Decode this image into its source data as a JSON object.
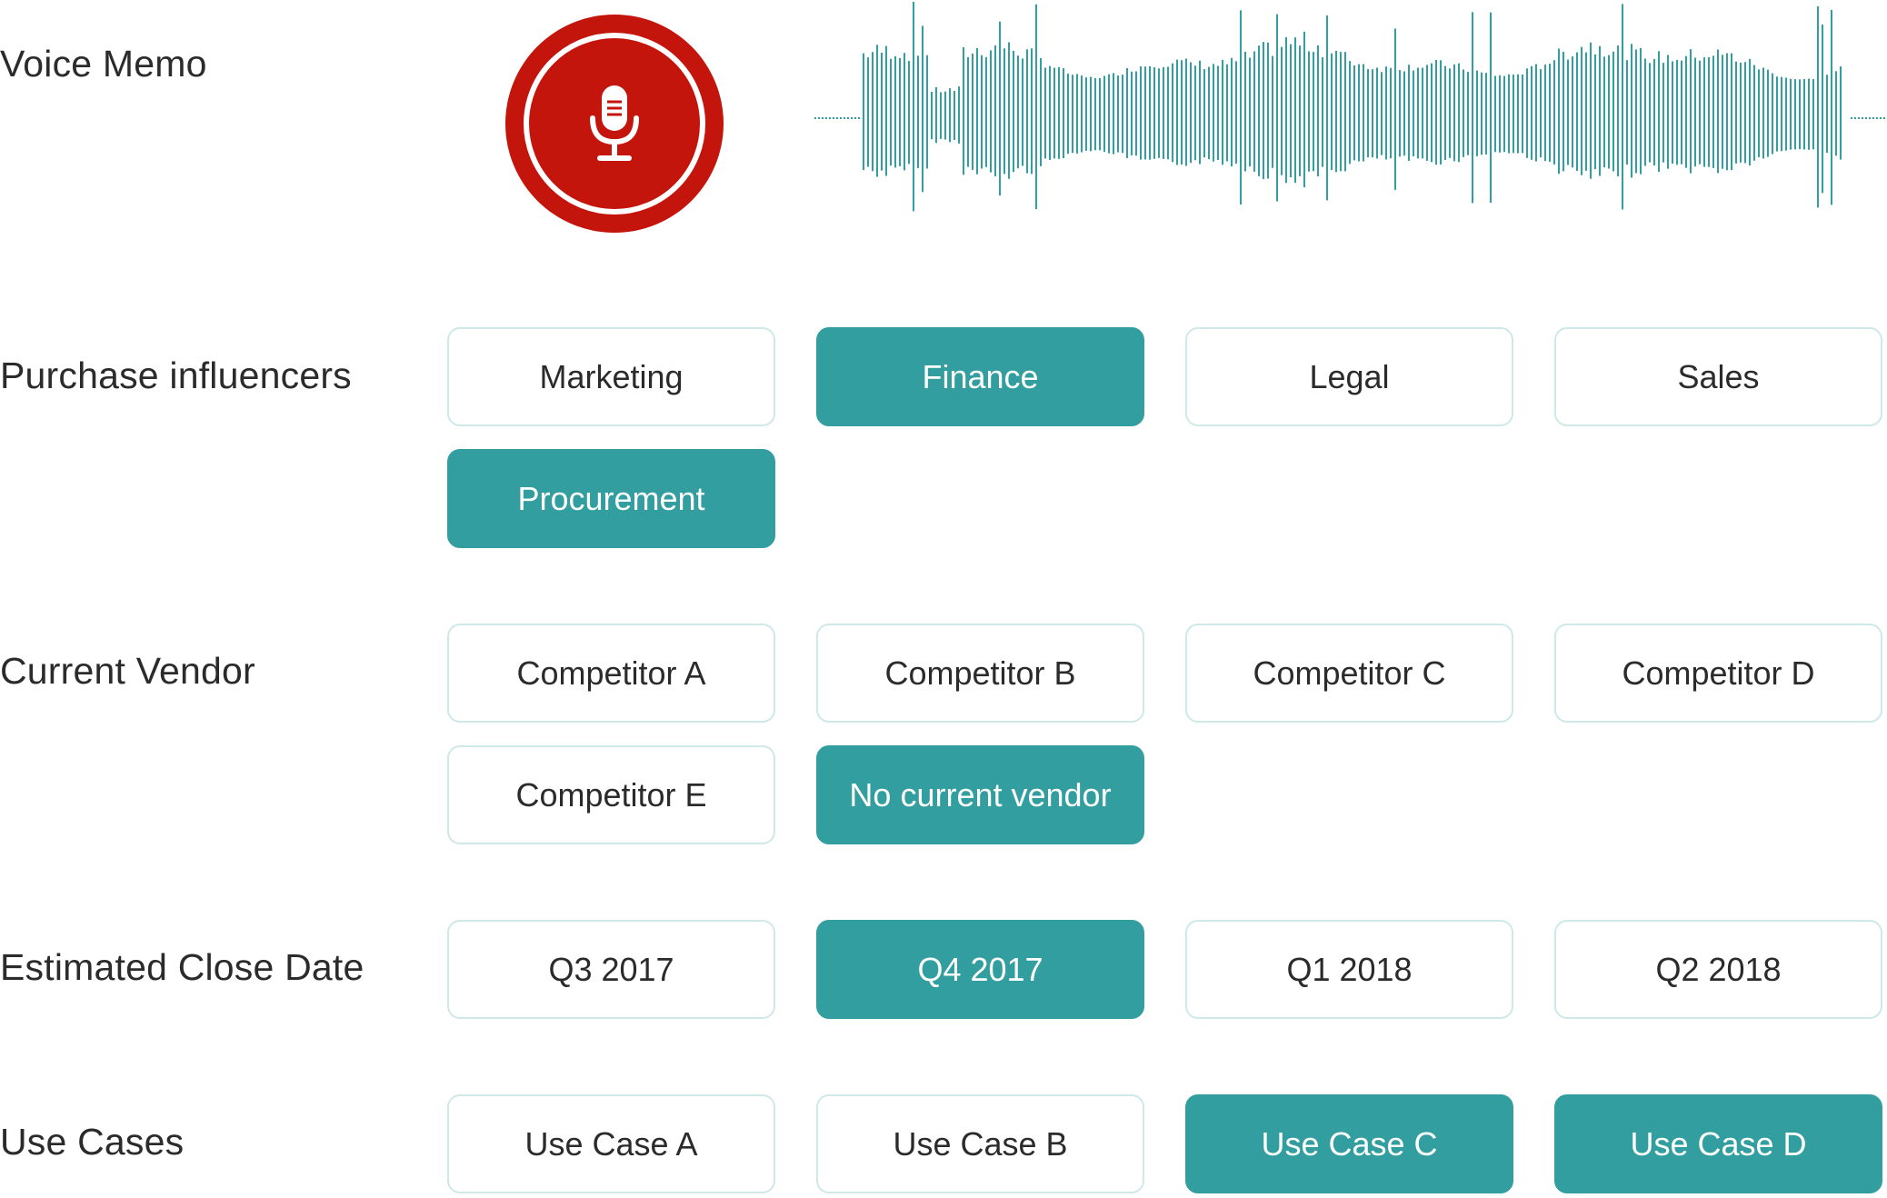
{
  "colors": {
    "accent": "#339e9f",
    "chip_border": "#cfe8e8",
    "record": "#c4150d",
    "waveform": "#339e9f",
    "text": "#2b2b2b"
  },
  "voice_memo": {
    "label": "Voice Memo",
    "record_icon": "microphone-icon"
  },
  "purchase_influencers": {
    "label": "Purchase influencers",
    "options": [
      {
        "label": "Marketing",
        "selected": false
      },
      {
        "label": "Finance",
        "selected": true
      },
      {
        "label": "Legal",
        "selected": false
      },
      {
        "label": "Sales",
        "selected": false
      },
      {
        "label": "Procurement",
        "selected": true
      }
    ]
  },
  "current_vendor": {
    "label": "Current Vendor",
    "options": [
      {
        "label": "Competitor A",
        "selected": false
      },
      {
        "label": "Competitor B",
        "selected": false
      },
      {
        "label": "Competitor C",
        "selected": false
      },
      {
        "label": "Competitor D",
        "selected": false
      },
      {
        "label": "Competitor E",
        "selected": false
      },
      {
        "label": "No current vendor",
        "selected": true
      }
    ]
  },
  "estimated_close_date": {
    "label": "Estimated Close Date",
    "options": [
      {
        "label": "Q3 2017",
        "selected": false
      },
      {
        "label": "Q4 2017",
        "selected": true
      },
      {
        "label": "Q1 2018",
        "selected": false
      },
      {
        "label": "Q2 2018",
        "selected": false
      }
    ]
  },
  "use_cases": {
    "label": "Use Cases",
    "options": [
      {
        "label": "Use Case A",
        "selected": false
      },
      {
        "label": "Use Case B",
        "selected": false
      },
      {
        "label": "Use Case C",
        "selected": true
      },
      {
        "label": "Use Case D",
        "selected": true
      }
    ]
  }
}
